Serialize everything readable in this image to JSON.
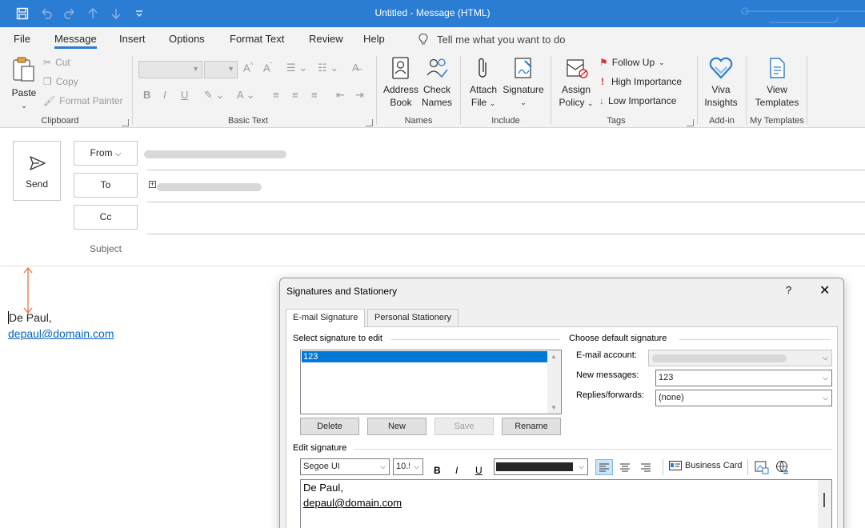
{
  "window": {
    "title": "Untitled  -  Message (HTML)"
  },
  "tabs": [
    "File",
    "Message",
    "Insert",
    "Options",
    "Format Text",
    "Review",
    "Help"
  ],
  "tell_me": "Tell me what you want to do",
  "ribbon": {
    "clipboard": {
      "paste": "Paste",
      "cut": "Cut",
      "copy": "Copy",
      "format_painter": "Format Painter",
      "label": "Clipboard"
    },
    "basic_text": {
      "label": "Basic Text"
    },
    "names": {
      "address_book_1": "Address",
      "address_book_2": "Book",
      "check_names_1": "Check",
      "check_names_2": "Names",
      "label": "Names"
    },
    "include": {
      "attach_1": "Attach",
      "attach_2": "File",
      "signature": "Signature",
      "label": "Include"
    },
    "tags": {
      "assign_1": "Assign",
      "assign_2": "Policy",
      "follow_up": "Follow Up",
      "high": "High Importance",
      "low": "Low Importance",
      "label": "Tags"
    },
    "addin": {
      "viva_1": "Viva",
      "viva_2": "Insights",
      "label": "Add-in"
    },
    "templates": {
      "view_1": "View",
      "view_2": "Templates",
      "label": "My Templates"
    }
  },
  "header": {
    "send": "Send",
    "from": "From",
    "to": "To",
    "cc": "Cc",
    "subject": "Subject"
  },
  "body": {
    "line1": "De Paul,",
    "email": "depaul@domain.com"
  },
  "dialog": {
    "title": "Signatures and Stationery",
    "help": "?",
    "tabs": [
      "E-mail Signature",
      "Personal Stationery"
    ],
    "select_label": "Select signature to edit",
    "signatures": [
      "123"
    ],
    "buttons": {
      "delete": "Delete",
      "new": "New",
      "save": "Save",
      "rename": "Rename"
    },
    "default_label": "Choose default signature",
    "email_account_label": "E-mail account:",
    "new_messages_label": "New messages:",
    "new_messages_value": "123",
    "replies_label": "Replies/forwards:",
    "replies_value": "(none)",
    "edit_label": "Edit signature",
    "font": "Segoe UI",
    "size": "10.5",
    "business_card": "Business Card",
    "editor_line1": "De Paul,",
    "editor_email": "depaul@domain.com"
  },
  "colors": {
    "accent": "#2b7cd3",
    "link": "#0563c1",
    "selection": "#0078d7"
  }
}
